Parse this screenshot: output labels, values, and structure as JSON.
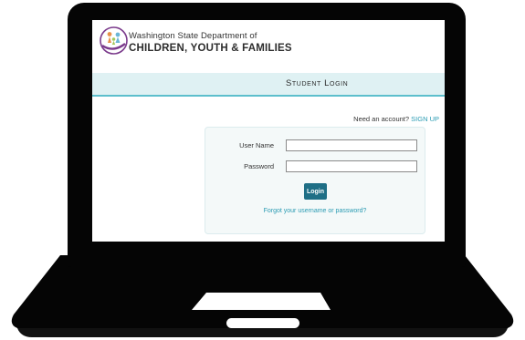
{
  "header": {
    "org_line1": "Washington State Department of",
    "org_line2": "CHILDREN, YOUTH & FAMILIES",
    "logo_icon": "dcyf-family-logo-icon"
  },
  "titlebar": {
    "title": "Student Login"
  },
  "signup": {
    "prompt": "Need an account?",
    "link_label": "SIGN UP"
  },
  "form": {
    "username_label": "User Name",
    "username_value": "",
    "password_label": "Password",
    "password_value": "",
    "login_label": "Login",
    "forgot_label": "Forgot your username or password?"
  },
  "colors": {
    "titlebar_bg": "#dff1f3",
    "titlebar_border": "#5cbfcc",
    "link": "#2a9bb3",
    "button": "#1f6f86",
    "laptop": "#050505"
  }
}
